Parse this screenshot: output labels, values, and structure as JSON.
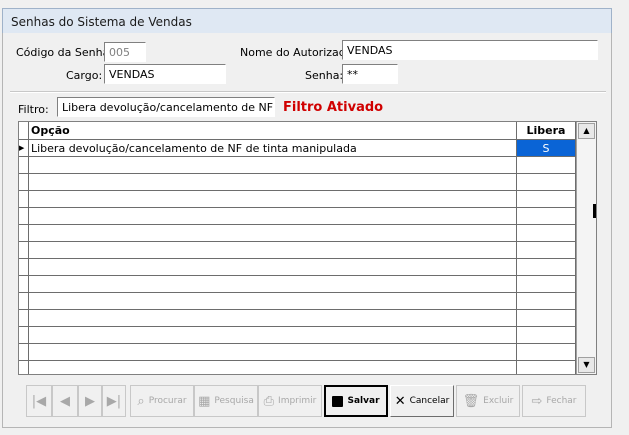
{
  "window": {
    "title": "Senhas do Sistema de Vendas"
  },
  "form": {
    "codigo_label": "Código da Senha:",
    "codigo_value": "005",
    "autorizado_label": "Nome do Autorizado:",
    "autorizado_value": "VENDAS",
    "cargo_label": "Cargo:",
    "cargo_value": "VENDAS",
    "senha_label": "Senha:",
    "senha_value": "**"
  },
  "filter": {
    "label": "Filtro:",
    "value": "Libera devolução/cancelamento de NF de tint",
    "status": "Filtro Ativado"
  },
  "grid": {
    "columns": [
      "Opção",
      "Libera"
    ],
    "rows": [
      {
        "indicator": "▶",
        "opcao": "Libera devolução/cancelamento de NF de tinta manipulada",
        "libera": "S"
      }
    ],
    "scroll_up": "▲",
    "scroll_down": "▼"
  },
  "toolbar": {
    "first": "|◀",
    "prev": "◀",
    "next": "▶",
    "last": "▶|",
    "procurar": "Procurar",
    "pesquisa": "Pesquisa",
    "imprimir": "Imprimir",
    "salvar": "Salvar",
    "cancelar": "Cancelar",
    "excluir": "Excluir",
    "fechar": "Fechar"
  }
}
